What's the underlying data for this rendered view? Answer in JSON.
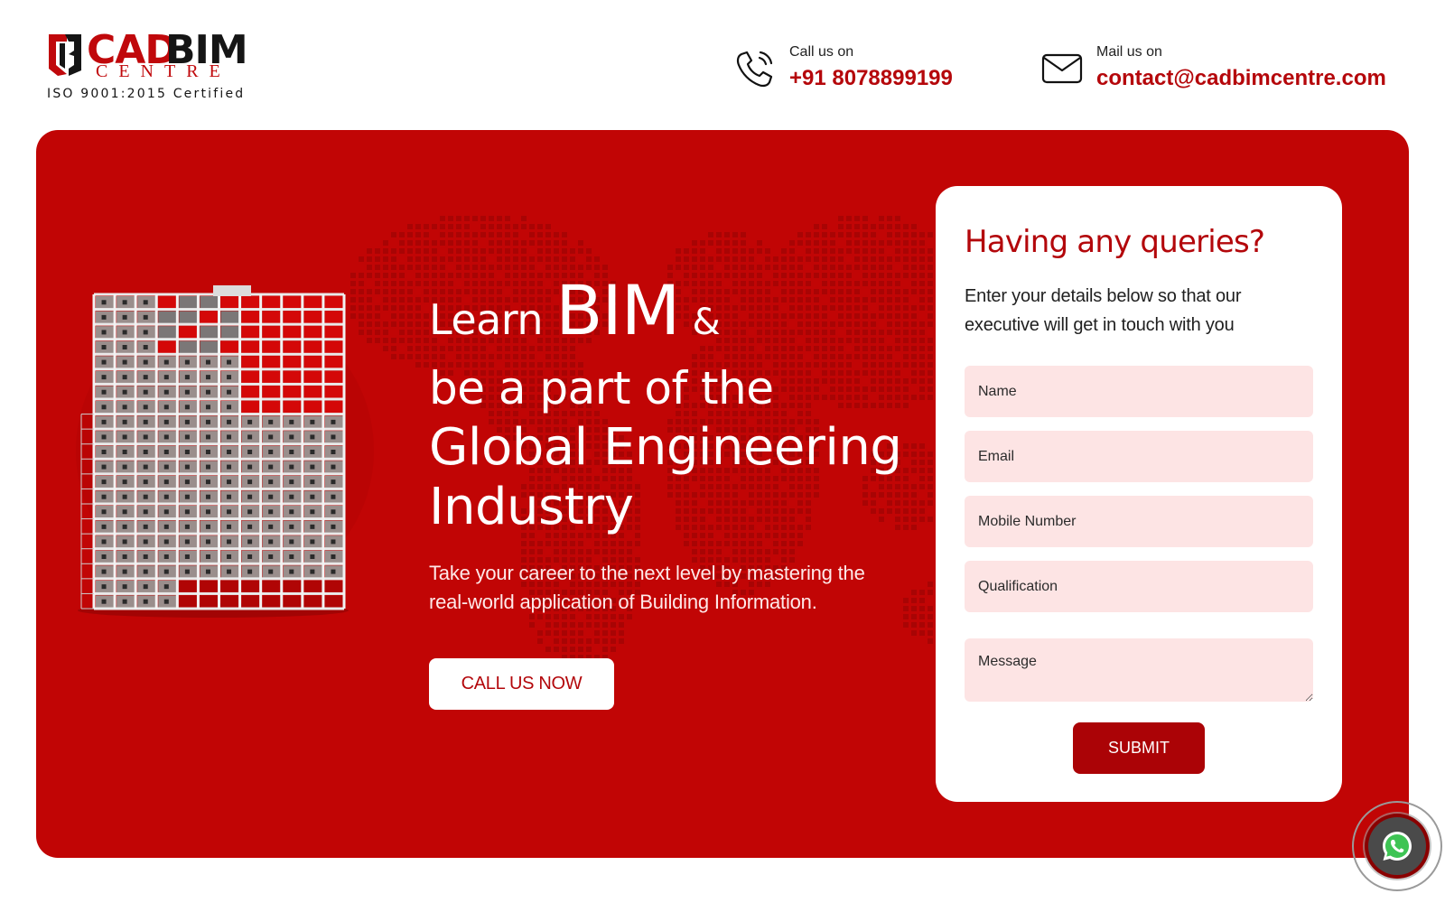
{
  "header": {
    "logo": {
      "cad": "CAD",
      "bim": "BIM",
      "centre": "CENTRE",
      "certification": "ISO 9001:2015 Certified"
    },
    "phone": {
      "icon": "phone-icon",
      "label": "Call us on",
      "value": "+91 8078899199"
    },
    "mail": {
      "icon": "mail-icon",
      "label": "Mail us on",
      "value": "contact@cadbimcentre.com"
    }
  },
  "hero": {
    "headline": {
      "learn": "Learn",
      "bim": "BIM",
      "amp": "&",
      "line2": "be a part of the",
      "line3": "Global Engineering",
      "line4": "Industry"
    },
    "subtext": "Take your career to the next level by mastering the real-world application of Building Information.",
    "cta_label": "CALL US NOW",
    "image": "building-structure-illustration",
    "background": "world-map-dots"
  },
  "form": {
    "title": "Having any queries?",
    "description": "Enter your details below so that our executive will get in touch with you",
    "fields": [
      {
        "name": "name",
        "placeholder": "Name",
        "value": ""
      },
      {
        "name": "email",
        "placeholder": "Email",
        "value": ""
      },
      {
        "name": "mobile",
        "placeholder": "Mobile Number",
        "value": ""
      },
      {
        "name": "qualification",
        "placeholder": "Qualification",
        "value": ""
      },
      {
        "name": "message",
        "placeholder": "Message",
        "value": ""
      }
    ],
    "submit_label": "SUBMIT"
  },
  "floating": {
    "whatsapp_icon": "whatsapp-icon"
  },
  "colors": {
    "brand_red": "#c10505",
    "accent_text": "#b3070b",
    "submit": "#ab0306",
    "field_bg": "#fde4e4",
    "whatsapp_green": "#25d366"
  }
}
